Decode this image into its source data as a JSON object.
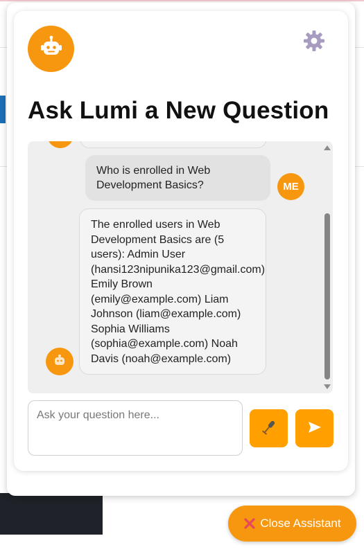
{
  "assistant": {
    "title": "Ask Lumi a New Question"
  },
  "chat": {
    "messages": [
      {
        "role": "user",
        "avatar_label": "ME",
        "text": "Who is enrolled in Web Development Basics?"
      },
      {
        "role": "assistant",
        "text": "The enrolled users in Web Development Basics are (5 users): Admin User (hansi123nipunika123@gmail.com) Emily Brown (emily@example.com) Liam Johnson (liam@example.com) Sophia Williams (sophia@example.com) Noah Davis (noah@example.com)"
      }
    ]
  },
  "input": {
    "placeholder": "Ask your question here...",
    "value": ""
  },
  "buttons": {
    "mic_icon": "microphone-icon",
    "send_icon": "send-arrow-icon",
    "close_label": "Close Assistant",
    "close_icon": "close-x-icon"
  },
  "icons": {
    "header": "robot-icon",
    "settings": "gear-icon"
  },
  "colors": {
    "accent": "#f7960f",
    "button": "#ffa000",
    "close_x": "#e8475c",
    "gear": "#a89bc0"
  }
}
